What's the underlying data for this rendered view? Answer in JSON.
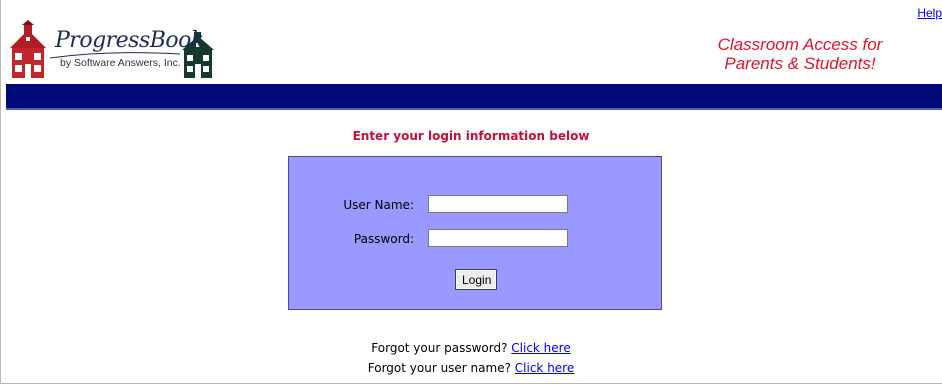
{
  "header": {
    "help_link": "Help",
    "logo_name": "ProgressBook",
    "logo_subtitle": "by Software Answers, Inc.",
    "tagline_line1": "Classroom Access for",
    "tagline_line2": "Parents & Students!"
  },
  "login": {
    "heading": "Enter your login information below",
    "username_label": "User Name:",
    "username_value": "",
    "password_label": "Password:",
    "password_value": "",
    "login_button": "Login"
  },
  "recovery": {
    "password_text": "Forgot your password?",
    "password_link": "Click here",
    "username_text": "Forgot your user name?",
    "username_link": "Click here"
  },
  "colors": {
    "banner_bar": "#000a78",
    "login_box": "#9999ff",
    "heading": "#c0123c",
    "tagline": "#d8172b",
    "link": "#0000ee"
  }
}
